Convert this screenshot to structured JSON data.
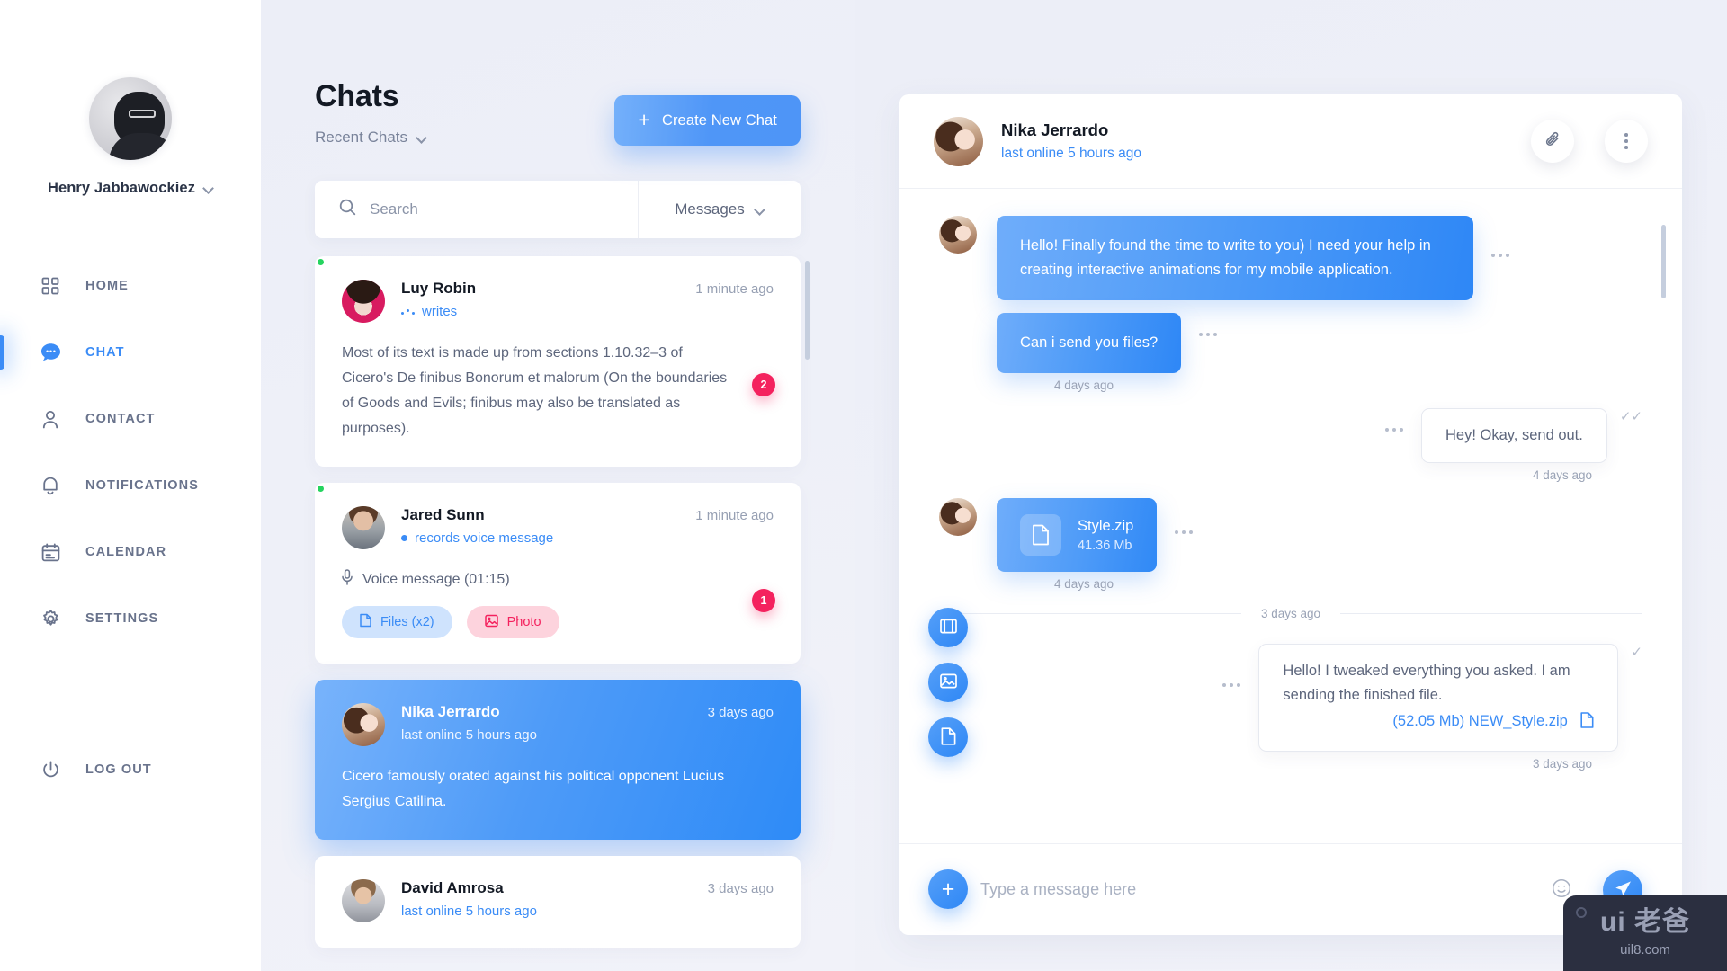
{
  "sidebar": {
    "user": {
      "name": "Henry Jabbawockiez",
      "avatar_icon": "user-photo",
      "chevron_icon": "chevron-down-icon"
    },
    "items": [
      {
        "label": "HOME",
        "icon": "grid-icon",
        "active": false
      },
      {
        "label": "CHAT",
        "icon": "chat-bubble-icon",
        "active": true
      },
      {
        "label": "CONTACT",
        "icon": "person-icon",
        "active": false
      },
      {
        "label": "NOTIFICATIONS",
        "icon": "bell-icon",
        "active": false
      },
      {
        "label": "CALENDAR",
        "icon": "calendar-icon",
        "active": false
      },
      {
        "label": "SETTINGS",
        "icon": "gear-icon",
        "active": false
      }
    ],
    "logout": {
      "label": "LOG OUT",
      "icon": "power-icon"
    }
  },
  "chats_panel": {
    "title": "Chats",
    "filter_label": "Recent Chats",
    "create_button": "Create New Chat",
    "create_plus_icon": "plus-icon",
    "search": {
      "placeholder": "Search",
      "value": "",
      "icon": "search-icon"
    },
    "messages_dropdown": {
      "label": "Messages",
      "icon": "chevron-down-icon"
    },
    "items": [
      {
        "name": "Luy Robin",
        "time": "1 minute ago",
        "status": "writes",
        "status_type": "typing",
        "online": true,
        "preview": "Most of its text is made up from sections 1.10.32–3 of Cicero's De finibus Bonorum et malorum (On the boundaries of Goods and Evils; finibus may also be translated as purposes).",
        "badge": "2",
        "selected": false
      },
      {
        "name": "Jared Sunn",
        "time": "1 minute ago",
        "status": "records voice message",
        "status_type": "recording",
        "online": true,
        "voice_label": "Voice message (01:15)",
        "voice_icon": "microphone-icon",
        "tags": [
          {
            "label": "Files (x2)",
            "icon": "file-icon",
            "style": "files"
          },
          {
            "label": "Photo",
            "icon": "image-icon",
            "style": "photo"
          }
        ],
        "badge": "1",
        "selected": false
      },
      {
        "name": "Nika Jerrardo",
        "time": "3 days ago",
        "status": "last online 5 hours ago",
        "status_type": "plain",
        "online": false,
        "preview": "Cicero famously orated against his political opponent Lucius Sergius Catilina.",
        "badge": "",
        "selected": true
      },
      {
        "name": "David Amrosa",
        "time": "3 days ago",
        "status": "last online 5 hours ago",
        "status_type": "plain",
        "online": false,
        "preview": "",
        "badge": "",
        "selected": false
      }
    ]
  },
  "conversation": {
    "header": {
      "name": "Nika Jerrardo",
      "status": "last online 5 hours ago",
      "attach_icon": "paperclip-icon",
      "more_icon": "kebab-menu-icon"
    },
    "messages": [
      {
        "id": "m1",
        "direction": "in",
        "type": "text",
        "text": "Hello! Finally found the time to write to you) I need your help in creating interactive animations for my mobile application.",
        "time": ""
      },
      {
        "id": "m2",
        "direction": "in",
        "type": "text",
        "text": "Can i send you files?",
        "time": "4 days ago"
      },
      {
        "id": "m3",
        "direction": "out",
        "type": "text",
        "text": "Hey! Okay, send out.",
        "time": "4 days ago",
        "read_status": "double-check"
      },
      {
        "id": "m4",
        "direction": "in",
        "type": "file",
        "file_name": "Style.zip",
        "file_size": "41.36 Mb",
        "file_icon": "document-icon",
        "time": "4 days ago"
      },
      {
        "id": "m5",
        "direction": "out",
        "type": "text_with_file",
        "text": "Hello! I tweaked everything you asked. I am sending the finished file.",
        "attachment_label": "(52.05 Mb) NEW_Style.zip",
        "attachment_icon": "document-icon",
        "time": "3 days ago",
        "read_status": "single-check"
      }
    ],
    "day_divider": "3 days ago",
    "attachment_buttons": [
      {
        "icon": "video-icon",
        "name": "attach-video"
      },
      {
        "icon": "image-icon",
        "name": "attach-image"
      },
      {
        "icon": "document-icon",
        "name": "attach-document"
      }
    ],
    "composer": {
      "add_icon": "plus-icon",
      "placeholder": "Type a message here",
      "value": "",
      "emoji_icon": "smiley-icon",
      "send_icon": "send-plane-icon"
    }
  },
  "watermark": {
    "logo": "ui 老爸",
    "url": "uil8.com"
  },
  "colors": {
    "accent": "#3b8cf6",
    "accent_deep": "#2e87f6",
    "badge": "#f4225e",
    "online": "#25d45f",
    "text_dark": "#131924",
    "text_muted": "#5d667c",
    "bg": "#eef0f8"
  }
}
